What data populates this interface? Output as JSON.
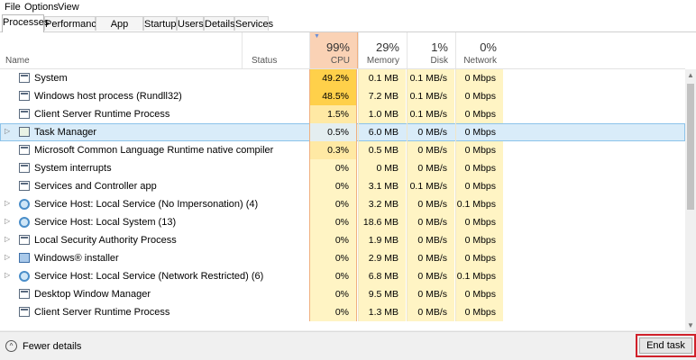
{
  "menu": [
    "File",
    "Options",
    "View"
  ],
  "tabs": [
    "Processes",
    "Performance",
    "App history",
    "Startup",
    "Users",
    "Details",
    "Services"
  ],
  "columns": {
    "name": "Name",
    "status": "Status",
    "cpu": {
      "pct": "99%",
      "label": "CPU"
    },
    "memory": {
      "pct": "29%",
      "label": "Memory"
    },
    "disk": {
      "pct": "1%",
      "label": "Disk"
    },
    "network": {
      "pct": "0%",
      "label": "Network"
    }
  },
  "processes": [
    {
      "name": "System",
      "cpu": "49.2%",
      "memory": "0.1 MB",
      "disk": "0.1 MB/s",
      "network": "0 Mbps"
    },
    {
      "name": "Windows host process (Rundll32)",
      "cpu": "48.5%",
      "memory": "7.2 MB",
      "disk": "0.1 MB/s",
      "network": "0 Mbps"
    },
    {
      "name": "Client Server Runtime Process",
      "cpu": "1.5%",
      "memory": "1.0 MB",
      "disk": "0.1 MB/s",
      "network": "0 Mbps"
    },
    {
      "name": "Task Manager",
      "cpu": "0.5%",
      "memory": "6.0 MB",
      "disk": "0 MB/s",
      "network": "0 Mbps"
    },
    {
      "name": "Microsoft Common Language Runtime native compiler",
      "cpu": "0.3%",
      "memory": "0.5 MB",
      "disk": "0 MB/s",
      "network": "0 Mbps"
    },
    {
      "name": "System interrupts",
      "cpu": "0%",
      "memory": "0 MB",
      "disk": "0 MB/s",
      "network": "0 Mbps"
    },
    {
      "name": "Services and Controller app",
      "cpu": "0%",
      "memory": "3.1 MB",
      "disk": "0.1 MB/s",
      "network": "0 Mbps"
    },
    {
      "name": "Service Host: Local Service (No Impersonation) (4)",
      "cpu": "0%",
      "memory": "3.2 MB",
      "disk": "0 MB/s",
      "network": "0.1 Mbps"
    },
    {
      "name": "Service Host: Local System (13)",
      "cpu": "0%",
      "memory": "18.6 MB",
      "disk": "0 MB/s",
      "network": "0 Mbps"
    },
    {
      "name": "Local Security Authority Process",
      "cpu": "0%",
      "memory": "1.9 MB",
      "disk": "0 MB/s",
      "network": "0 Mbps"
    },
    {
      "name": "Windows® installer",
      "cpu": "0%",
      "memory": "2.9 MB",
      "disk": "0 MB/s",
      "network": "0 Mbps"
    },
    {
      "name": "Service Host: Local Service (Network Restricted) (6)",
      "cpu": "0%",
      "memory": "6.8 MB",
      "disk": "0 MB/s",
      "network": "0.1 Mbps"
    },
    {
      "name": "Desktop Window Manager",
      "cpu": "0%",
      "memory": "9.5 MB",
      "disk": "0 MB/s",
      "network": "0 Mbps"
    },
    {
      "name": "Client Server Runtime Process",
      "cpu": "0%",
      "memory": "1.3 MB",
      "disk": "0 MB/s",
      "network": "0 Mbps"
    }
  ],
  "footer": {
    "fewer_details": "Fewer details",
    "end_task": "End task"
  }
}
